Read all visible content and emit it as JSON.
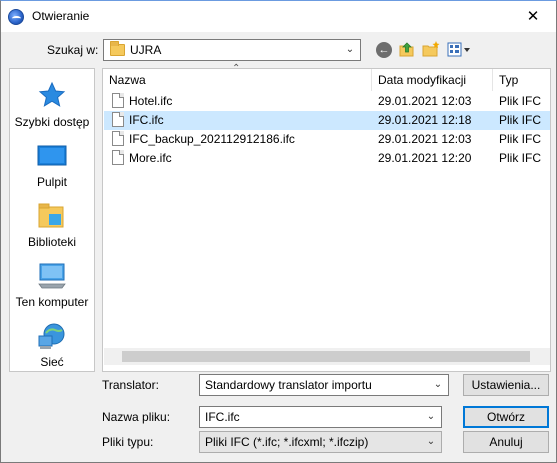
{
  "window": {
    "title": "Otwieranie",
    "close": "✕"
  },
  "lookin": {
    "label": "Szukaj w:",
    "value": "UJRA"
  },
  "places": [
    {
      "label": "Szybki dostęp"
    },
    {
      "label": "Pulpit"
    },
    {
      "label": "Biblioteki"
    },
    {
      "label": "Ten komputer"
    },
    {
      "label": "Sieć"
    }
  ],
  "columns": {
    "name": "Nazwa",
    "date": "Data modyfikacji",
    "type": "Typ"
  },
  "files": [
    {
      "name": "Hotel.ifc",
      "date": "29.01.2021 12:03",
      "type": "Plik IFC",
      "selected": false
    },
    {
      "name": "IFC.ifc",
      "date": "29.01.2021 12:18",
      "type": "Plik IFC",
      "selected": true
    },
    {
      "name": "IFC_backup_202112912186.ifc",
      "date": "29.01.2021 12:03",
      "type": "Plik IFC",
      "selected": false
    },
    {
      "name": "More.ifc",
      "date": "29.01.2021 12:20",
      "type": "Plik IFC",
      "selected": false
    }
  ],
  "translator": {
    "label": "Translator:",
    "value": "Standardowy translator importu",
    "settings_button": "Ustawienia..."
  },
  "filename": {
    "label": "Nazwa pliku:",
    "value": "IFC.ifc"
  },
  "filetype": {
    "label": "Pliki typu:",
    "value": "Pliki IFC (*.ifc; *.ifcxml; *.ifczip)"
  },
  "buttons": {
    "open": "Otwórz",
    "cancel": "Anuluj"
  },
  "colors": {
    "selection": "#cce8ff",
    "accent": "#0078d7"
  }
}
